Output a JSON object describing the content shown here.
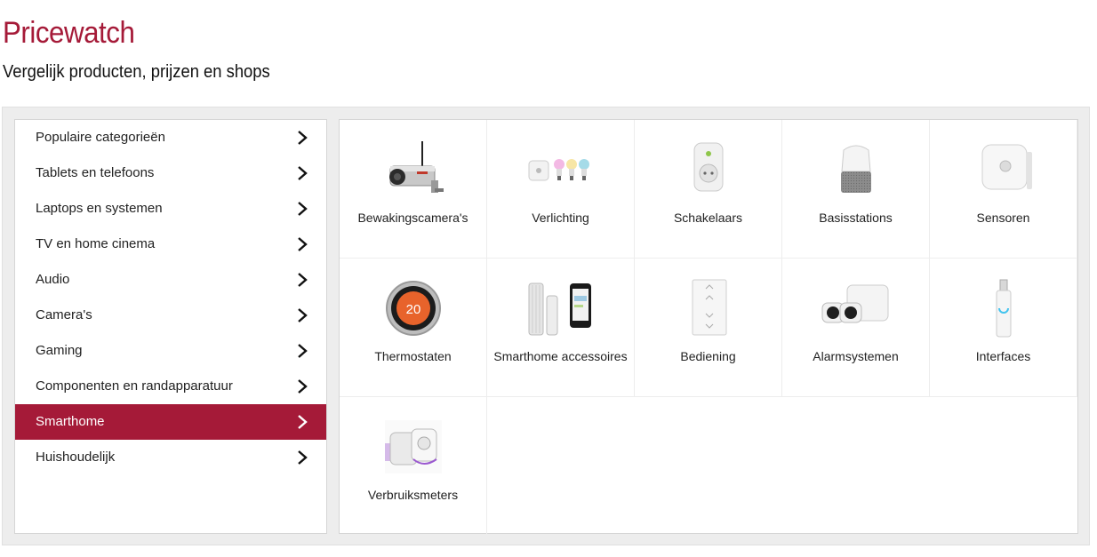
{
  "header": {
    "title": "Pricewatch",
    "subtitle": "Vergelijk producten, prijzen en shops"
  },
  "colors": {
    "accent": "#a51a38",
    "panel_bg": "#ededed"
  },
  "menu": {
    "items": [
      {
        "label": "Populaire categorieën",
        "icon": "chevron-right-icon"
      },
      {
        "label": "Tablets en telefoons",
        "icon": "chevron-right-icon"
      },
      {
        "label": "Laptops en systemen",
        "icon": "chevron-right-icon"
      },
      {
        "label": "TV en home cinema",
        "icon": "chevron-right-icon"
      },
      {
        "label": "Audio",
        "icon": "chevron-right-icon"
      },
      {
        "label": "Camera's",
        "icon": "chevron-right-icon"
      },
      {
        "label": "Gaming",
        "icon": "chevron-right-icon"
      },
      {
        "label": "Componenten en randapparatuur",
        "icon": "chevron-right-icon"
      },
      {
        "label": "Smarthome",
        "icon": "chevron-right-icon",
        "active": true
      },
      {
        "label": "Huishoudelijk",
        "icon": "chevron-right-icon"
      }
    ]
  },
  "categories": [
    {
      "label": "Bewakingscamera's",
      "icon": "security-camera-icon"
    },
    {
      "label": "Verlichting",
      "icon": "smart-bulbs-icon"
    },
    {
      "label": "Schakelaars",
      "icon": "smart-plug-icon"
    },
    {
      "label": "Basisstations",
      "icon": "smart-speaker-icon"
    },
    {
      "label": "Sensoren",
      "icon": "motion-sensor-icon"
    },
    {
      "label": "Thermostaten",
      "icon": "thermostat-icon"
    },
    {
      "label": "Smarthome accessoires",
      "icon": "weather-station-icon"
    },
    {
      "label": "Bediening",
      "icon": "dimmer-switch-icon"
    },
    {
      "label": "Alarmsystemen",
      "icon": "alarm-camera-icon"
    },
    {
      "label": "Interfaces",
      "icon": "usb-stick-icon"
    },
    {
      "label": "Verbruiksmeters",
      "icon": "energy-meter-plug-icon"
    }
  ],
  "thermostat_display": "20"
}
